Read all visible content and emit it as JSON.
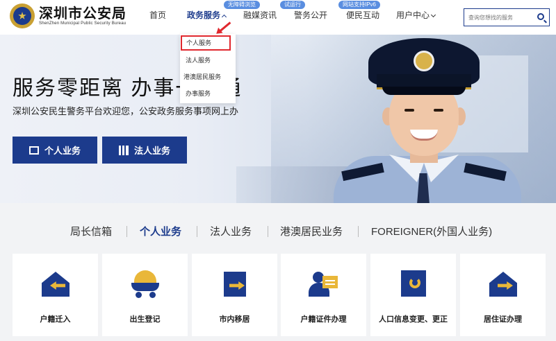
{
  "header": {
    "logo_cn": "深圳市公安局",
    "logo_en": "ShenZhen Municipal Public Security Bureau",
    "nav": [
      "首页",
      "政务服务",
      "融媒资讯",
      "警务公开",
      "便民互动",
      "用户中心"
    ],
    "pills": [
      "无障碍浏览",
      "试运行",
      "网站支持IPv6"
    ],
    "search_placeholder": "查询您想找的服务"
  },
  "dropdown": {
    "items": [
      "个人服务",
      "法人服务",
      "港澳居民服务",
      "办事服务"
    ]
  },
  "banner": {
    "headline": "服务零距离 办事一站通",
    "subline": "深圳公安民生警务平台欢迎您，公安政务服务事项网上办",
    "btn_personal": "个人业务",
    "btn_legal": "法人业务"
  },
  "tabs": [
    "局长信箱",
    "个人业务",
    "法人业务",
    "港澳居民业务",
    "FOREIGNER(外国人业务)"
  ],
  "cards": [
    "户籍迁入",
    "出生登记",
    "市内移居",
    "户籍证件办理",
    "人口信息变更、更正",
    "居住证办理"
  ],
  "colors": {
    "brand": "#1c3b8c",
    "accent": "#e9b739",
    "highlight": "#e0282e"
  }
}
